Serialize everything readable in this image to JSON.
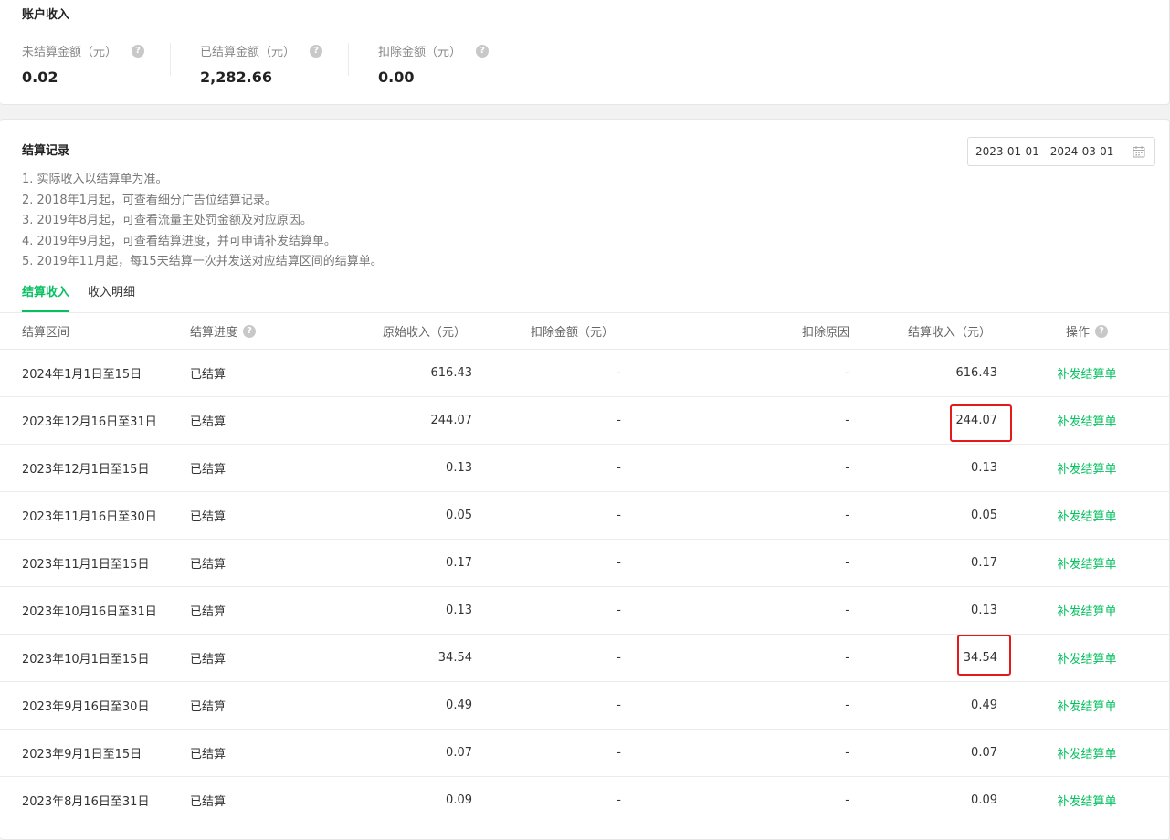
{
  "account": {
    "title": "账户收入",
    "stats": [
      {
        "label": "未结算金额（元）",
        "value": "0.02"
      },
      {
        "label": "已结算金额（元）",
        "value": "2,282.66"
      },
      {
        "label": "扣除金额（元）",
        "value": "0.00"
      }
    ],
    "help_glyph": "?"
  },
  "records": {
    "title": "结算记录",
    "date_range": "2023-01-01 - 2024-03-01",
    "notes": [
      "1. 实际收入以结算单为准。",
      "2. 2018年1月起，可查看细分广告位结算记录。",
      "3. 2019年8月起，可查看流量主处罚金额及对应原因。",
      "4. 2019年9月起，可查看结算进度，并可申请补发结算单。",
      "5. 2019年11月起，每15天结算一次并发送对应结算区间的结算单。"
    ],
    "tabs": [
      {
        "label": "结算收入",
        "active": true
      },
      {
        "label": "收入明细",
        "active": false
      }
    ],
    "columns": {
      "period": "结算区间",
      "progress": "结算进度",
      "original": "原始收入（元）",
      "deduct": "扣除金额（元）",
      "reason": "扣除原因",
      "income": "结算收入（元）",
      "action": "操作"
    },
    "rows": [
      {
        "period": "2024年1月1日至15日",
        "progress": "已结算",
        "original": "616.43",
        "deduct": "-",
        "reason": "-",
        "income": "616.43",
        "action": "补发结算单"
      },
      {
        "period": "2023年12月16日至31日",
        "progress": "已结算",
        "original": "244.07",
        "deduct": "-",
        "reason": "-",
        "income": "244.07",
        "action": "补发结算单"
      },
      {
        "period": "2023年12月1日至15日",
        "progress": "已结算",
        "original": "0.13",
        "deduct": "-",
        "reason": "-",
        "income": "0.13",
        "action": "补发结算单"
      },
      {
        "period": "2023年11月16日至30日",
        "progress": "已结算",
        "original": "0.05",
        "deduct": "-",
        "reason": "-",
        "income": "0.05",
        "action": "补发结算单"
      },
      {
        "period": "2023年11月1日至15日",
        "progress": "已结算",
        "original": "0.17",
        "deduct": "-",
        "reason": "-",
        "income": "0.17",
        "action": "补发结算单"
      },
      {
        "period": "2023年10月16日至31日",
        "progress": "已结算",
        "original": "0.13",
        "deduct": "-",
        "reason": "-",
        "income": "0.13",
        "action": "补发结算单"
      },
      {
        "period": "2023年10月1日至15日",
        "progress": "已结算",
        "original": "34.54",
        "deduct": "-",
        "reason": "-",
        "income": "34.54",
        "action": "补发结算单"
      },
      {
        "period": "2023年9月16日至30日",
        "progress": "已结算",
        "original": "0.49",
        "deduct": "-",
        "reason": "-",
        "income": "0.49",
        "action": "补发结算单"
      },
      {
        "period": "2023年9月1日至15日",
        "progress": "已结算",
        "original": "0.07",
        "deduct": "-",
        "reason": "-",
        "income": "0.07",
        "action": "补发结算单"
      },
      {
        "period": "2023年8月16日至31日",
        "progress": "已结算",
        "original": "0.09",
        "deduct": "-",
        "reason": "-",
        "income": "0.09",
        "action": "补发结算单"
      }
    ]
  },
  "colors": {
    "accent": "#07c160",
    "highlight": "#e5191b"
  }
}
